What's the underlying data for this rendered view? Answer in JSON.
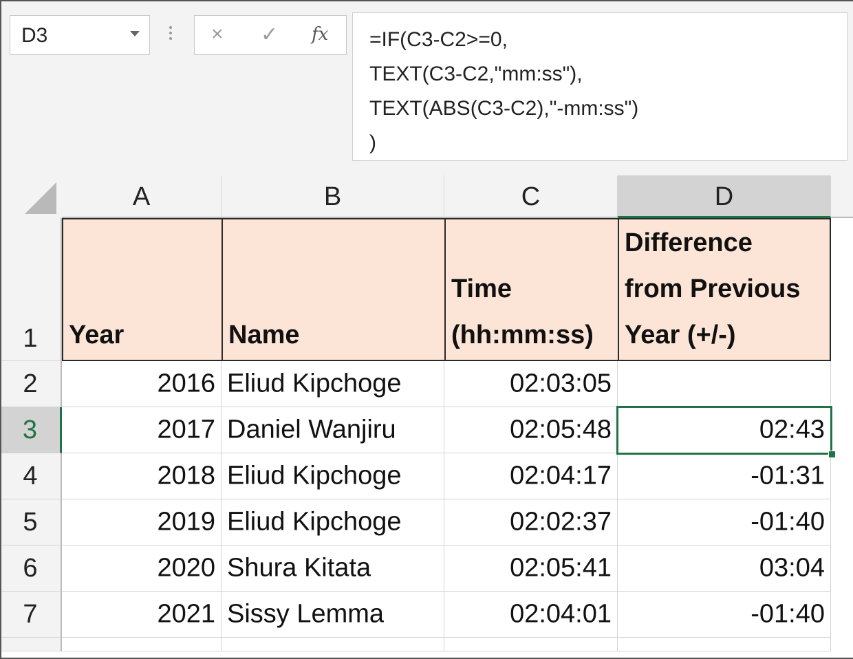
{
  "name_box": {
    "ref": "D3"
  },
  "formula_bar": {
    "cancel_glyph": "×",
    "enter_glyph": "✓",
    "fx_glyph": "fx",
    "lines": [
      "=IF(C3-C2>=0,",
      "TEXT(C3-C2,\"mm:ss\"),",
      "TEXT(ABS(C3-C2),\"-mm:ss\")",
      ")"
    ]
  },
  "columns": [
    "A",
    "B",
    "C",
    "D"
  ],
  "selected_column": "D",
  "selected_row": "3",
  "header_row": {
    "row_label": "1",
    "year": "Year",
    "name": "Name",
    "time_line1": "Time",
    "time_line2": "(hh:mm:ss)",
    "diff_line1": "Difference",
    "diff_line2": "from Previous",
    "diff_line3": "Year (+/-)"
  },
  "rows": [
    {
      "row_label": "2",
      "year": "2016",
      "name": "Eliud Kipchoge",
      "time": "02:03:05",
      "diff": ""
    },
    {
      "row_label": "3",
      "year": "2017",
      "name": "Daniel Wanjiru",
      "time": "02:05:48",
      "diff": "02:43"
    },
    {
      "row_label": "4",
      "year": "2018",
      "name": "Eliud Kipchoge",
      "time": "02:04:17",
      "diff": "-01:31"
    },
    {
      "row_label": "5",
      "year": "2019",
      "name": "Eliud Kipchoge",
      "time": "02:02:37",
      "diff": "-01:40"
    },
    {
      "row_label": "6",
      "year": "2020",
      "name": "Shura Kitata",
      "time": "02:05:41",
      "diff": "03:04"
    },
    {
      "row_label": "7",
      "year": "2021",
      "name": "Sissy Lemma",
      "time": "02:04:01",
      "diff": "-01:40"
    }
  ],
  "colors": {
    "selection": "#217346",
    "header_fill": "#fce4d6"
  }
}
